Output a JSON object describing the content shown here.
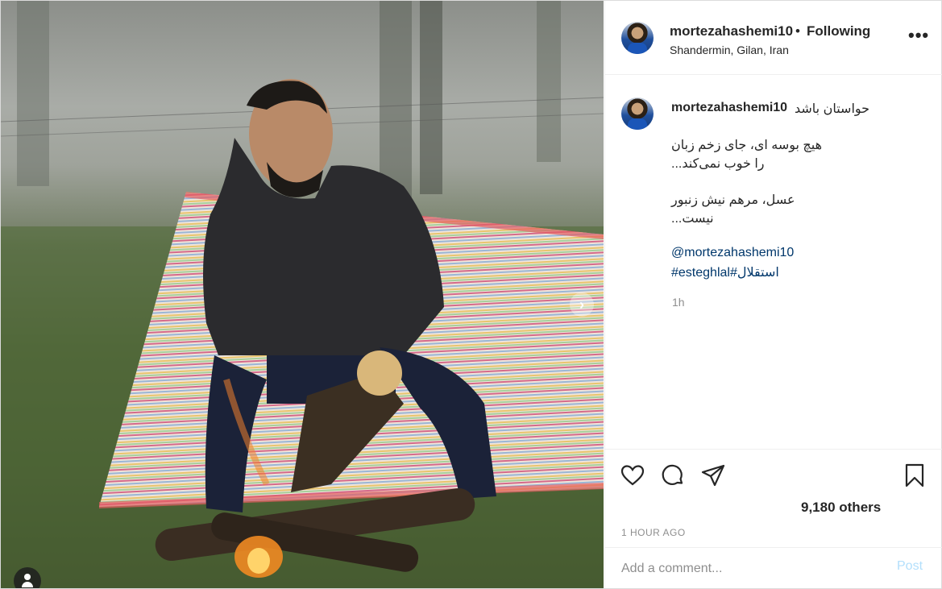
{
  "post": {
    "photo_alt": "",
    "next_icon": "chevron-right-icon"
  },
  "header": {
    "username": "mortezahashemi10",
    "separator": "•",
    "follow_status": "Following",
    "location": "Shandermin, Gilan, Iran",
    "more_icon": "•••"
  },
  "caption": {
    "username": "mortezahashemi10",
    "first_line": "حواستان باشد",
    "lines": [
      "هیچ بوسه ای، جای زخم زبان",
      "...را خوب نمی‌کند",
      "عسل، مرهم نیش زنبور",
      "...نیست"
    ],
    "mention": "@mortezahashemi10",
    "hashtags": "#esteghlal#استقلال",
    "time": "1h"
  },
  "actions": {
    "likes": "9,180 others",
    "post_time": "1 HOUR AGO"
  },
  "add_comment": {
    "placeholder": "Add a comment...",
    "post_label": "Post"
  },
  "colors": {
    "link": "#00376b",
    "muted": "#8e8e8e",
    "post_disabled": "#b2dffc"
  }
}
